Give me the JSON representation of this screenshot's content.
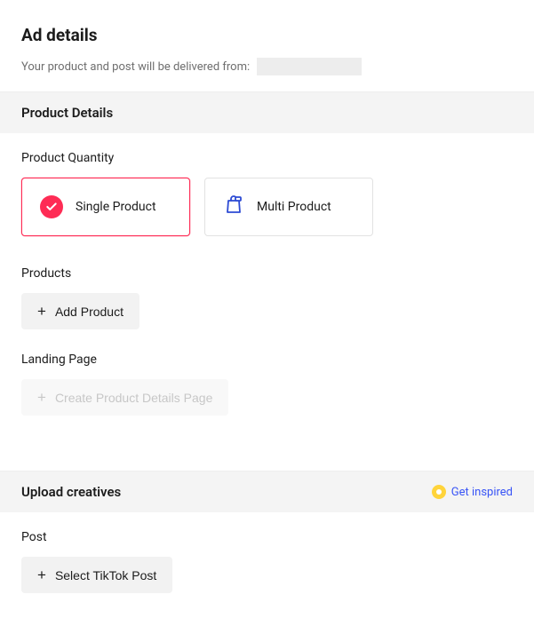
{
  "header": {
    "page_title": "Ad details",
    "delivery_prefix": "Your product and post will be delivered from:"
  },
  "sections": {
    "product_details": {
      "title": "Product Details",
      "quantity_label": "Product Quantity",
      "options": {
        "single": "Single Product",
        "multi": "Multi Product"
      },
      "products_label": "Products",
      "add_product_label": "Add Product",
      "landing_page_label": "Landing Page",
      "create_pdp_label": "Create Product Details Page"
    },
    "upload_creatives": {
      "title": "Upload creatives",
      "get_inspired_label": "Get inspired",
      "post_label": "Post",
      "select_post_label": "Select TikTok Post"
    }
  },
  "colors": {
    "accent": "#fe2c55",
    "link": "#3955f6",
    "bulb": "#ffd43b"
  }
}
